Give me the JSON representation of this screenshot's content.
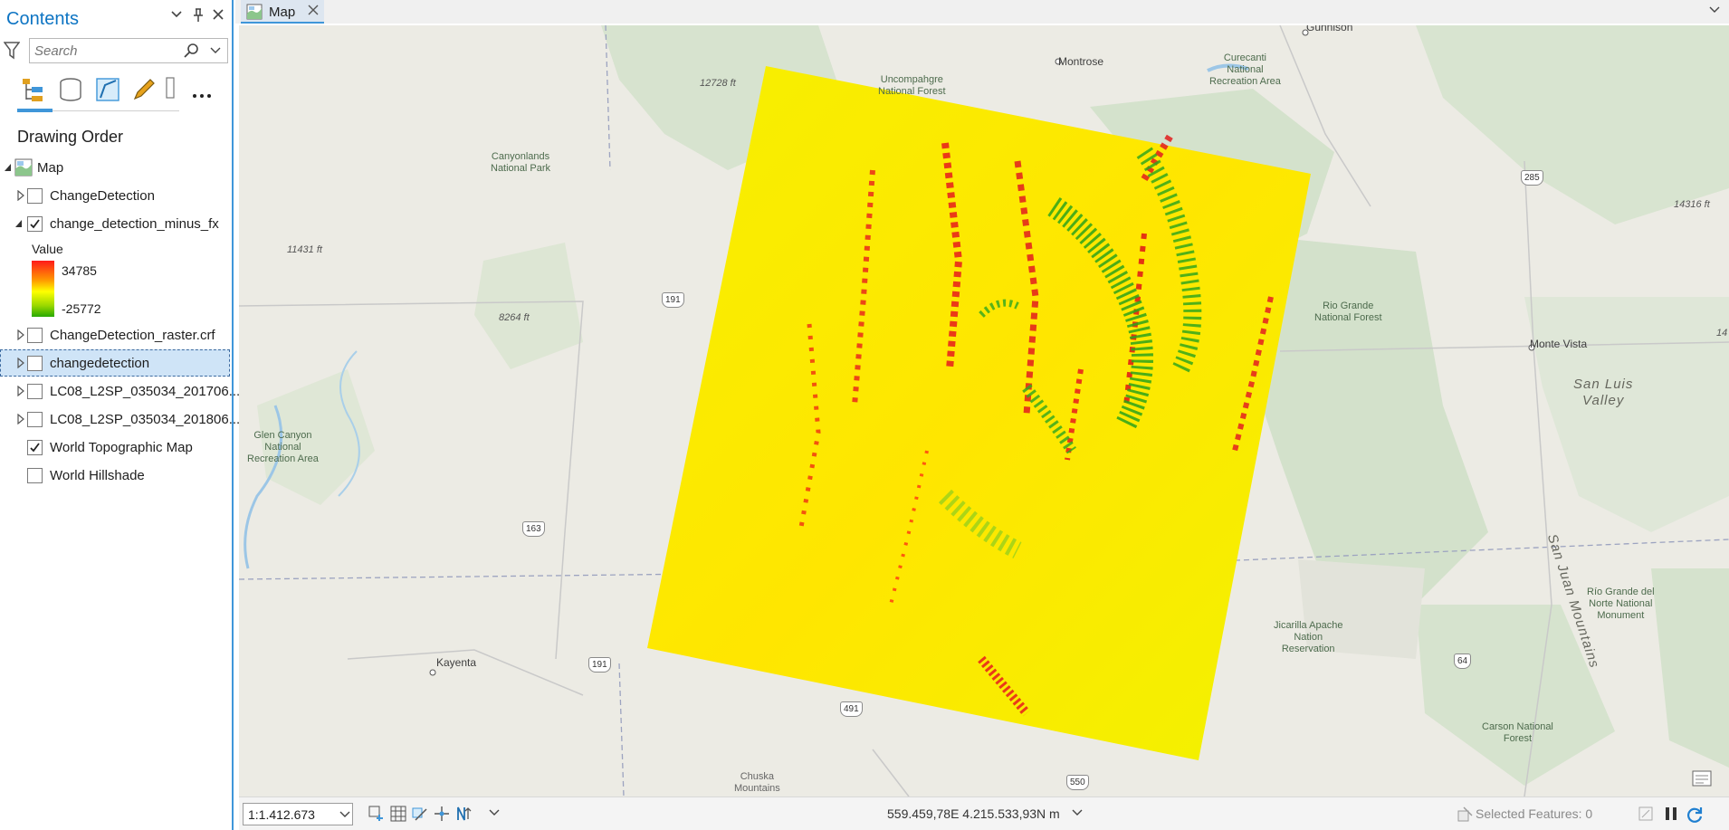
{
  "contents": {
    "title": "Contents",
    "search_placeholder": "Search",
    "drawing_order_label": "Drawing Order",
    "layers": [
      {
        "label": "Map"
      },
      {
        "label": "ChangeDetection",
        "checked": false
      },
      {
        "label": "change_detection_minus_fx",
        "checked": true
      },
      {
        "label": "ChangeDetection_raster.crf",
        "checked": false
      },
      {
        "label": "changedetection",
        "checked": false,
        "selected": true
      },
      {
        "label": "LC08_L2SP_035034_201706...",
        "checked": false
      },
      {
        "label": "LC08_L2SP_035034_201806...",
        "checked": false
      },
      {
        "label": "World Topographic Map",
        "checked": true
      },
      {
        "label": "World Hillshade",
        "checked": false
      }
    ],
    "legend": {
      "title": "Value",
      "high": "34785",
      "low": "-25772"
    }
  },
  "map_tab": {
    "label": "Map"
  },
  "map": {
    "places": {
      "gunnison": "Gunnison",
      "montrose": "Montrose",
      "monte_vista": "Monte Vista",
      "kayenta": "Kayenta"
    },
    "parks": {
      "curecanti": "Curecanti\nNational\nRecreation Area",
      "uncompahgre": "Uncompahgre\nNational Forest",
      "canyonlands": "Canyonlands\nNational Park",
      "rio_grande": "Rio Grande\nNational Forest",
      "glen_canyon": "Glen Canyon\nNational\nRecreation Area",
      "jicarilla": "Jicarilla Apache\nNation\nReservation",
      "rio_grande_monument": "Río Grande del\nNorte National\nMonument",
      "carson": "Carson National\nForest",
      "chuska": "Chuska\nMountains"
    },
    "elevations": {
      "e12728": "12728 ft",
      "e14316": "14316 ft",
      "e11431": "11431 ft",
      "e8264": "8264 ft",
      "e143": "14"
    },
    "big_labels": {
      "san_luis": "San Luis\nValley",
      "san_juan": "San Juan Mountains"
    },
    "shields": {
      "r285": "285",
      "r191a": "191",
      "r163": "163",
      "r191b": "191",
      "r491": "491",
      "r64": "64",
      "r550": "550"
    }
  },
  "statusbar": {
    "scale": "1:1.412.673",
    "coordinates": "559.459,78E 4.215.533,93N m",
    "selected_features": "Selected Features: 0"
  },
  "colors": {
    "accent": "#3f96d9",
    "title_blue": "#0d74c3",
    "raster_high": "#ff1a1a",
    "raster_mid": "#ffff00",
    "raster_low": "#28a800"
  }
}
